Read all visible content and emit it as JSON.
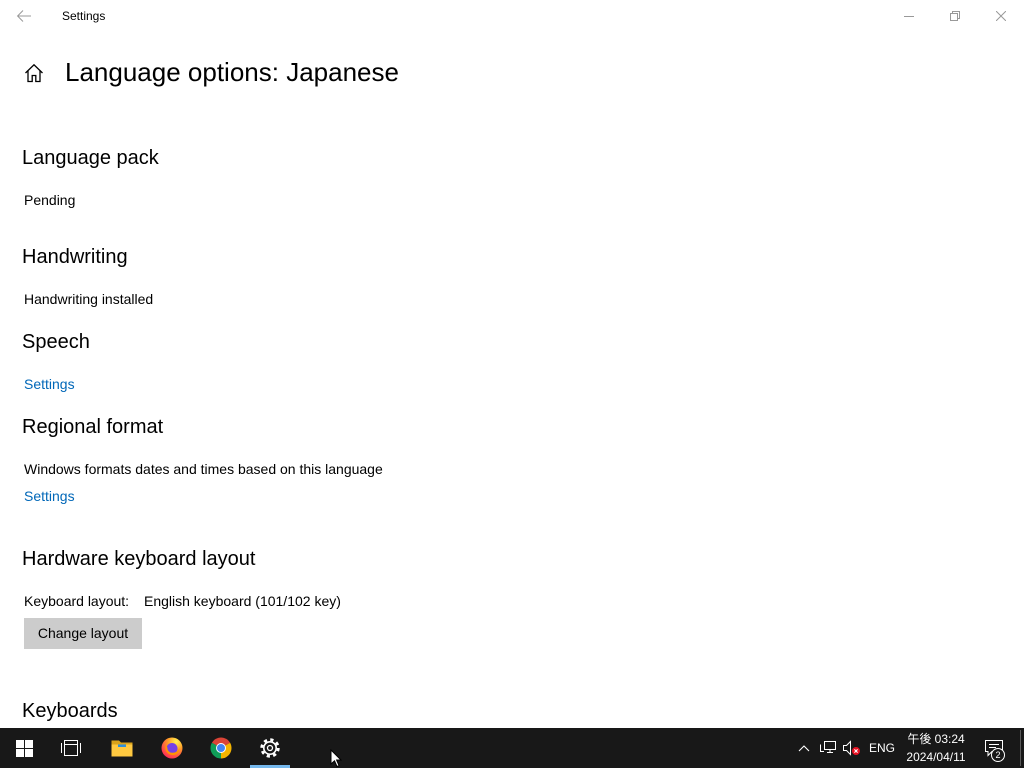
{
  "titlebar": {
    "title": "Settings",
    "icons": {
      "back": "back-arrow-icon",
      "minimize": "minimize-icon",
      "restore": "restore-icon",
      "close": "close-icon"
    }
  },
  "page": {
    "home_icon": "home-icon",
    "title": "Language options: Japanese"
  },
  "sections": {
    "language_pack": {
      "heading": "Language pack",
      "status": "Pending"
    },
    "handwriting": {
      "heading": "Handwriting",
      "status": "Handwriting installed"
    },
    "speech": {
      "heading": "Speech",
      "link": "Settings"
    },
    "regional_format": {
      "heading": "Regional format",
      "description": "Windows formats dates and times based on this language",
      "link": "Settings"
    },
    "hardware_keyboard_layout": {
      "heading": "Hardware keyboard layout",
      "label": "Keyboard layout:",
      "value": "English keyboard (101/102 key)",
      "button": "Change layout"
    },
    "keyboards": {
      "heading": "Keyboards"
    }
  },
  "taskbar": {
    "apps": [
      {
        "icon": "windows-logo-icon"
      },
      {
        "icon": "task-view-icon"
      },
      {
        "icon": "folder-icon"
      },
      {
        "icon": "firefox-icon"
      },
      {
        "icon": "chrome-icon"
      },
      {
        "icon": "gear-icon",
        "active": true
      }
    ],
    "tray": {
      "icons": [
        "chevron-up-icon",
        "network-icon",
        "volume-muted-icon"
      ],
      "language": "ENG",
      "time": "午後 03:24",
      "date": "2024/04/11",
      "notification_icon": "notification-icon",
      "notification_count": "2"
    }
  },
  "colors": {
    "link": "#0067b8",
    "taskbar": "#181818",
    "active_indicator": "#76b9ed",
    "button": "#cccccc",
    "mute_badge": "#e81123"
  }
}
